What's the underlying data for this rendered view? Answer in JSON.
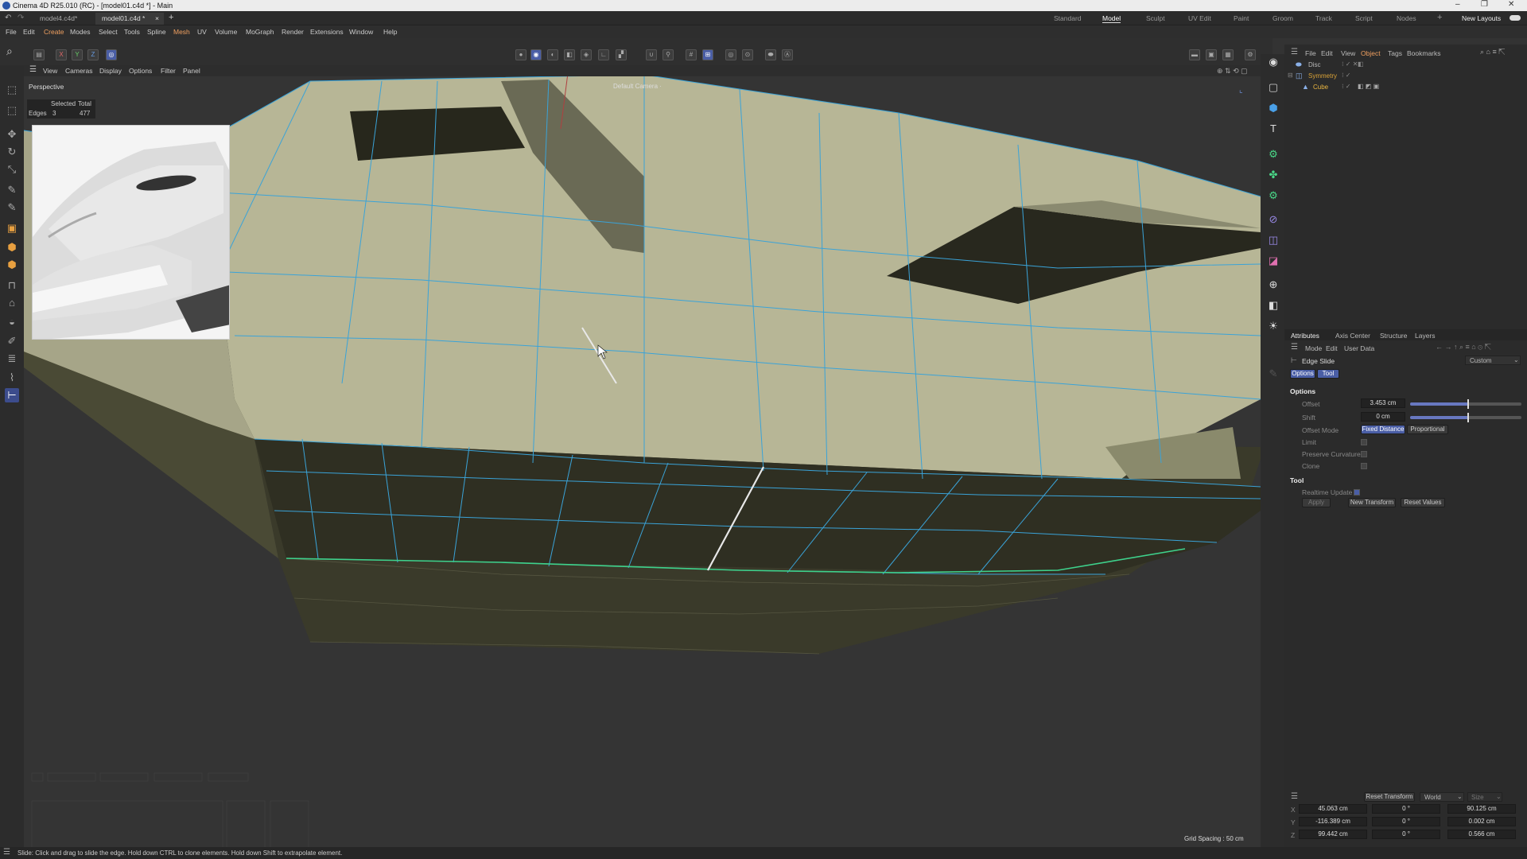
{
  "window": {
    "title": "Cinema 4D R25.010 (RC) - [model01.c4d *] - Main",
    "controls": [
      "–",
      "❐",
      "✕"
    ]
  },
  "tabs": {
    "docs": [
      "model4.c4d*",
      "model01.c4d *"
    ],
    "add": "+",
    "layouts": [
      "Standard",
      "Model",
      "Sculpt",
      "UV Edit",
      "Paint",
      "Groom",
      "Track",
      "Script",
      "Nodes"
    ],
    "active_layout": "Model",
    "new_layouts": "New Layouts"
  },
  "menu": [
    "File",
    "Edit",
    "Create",
    "Modes",
    "Select",
    "Tools",
    "Spline",
    "Mesh",
    "UV",
    "Volume",
    "MoGraph",
    "Render",
    "Extensions",
    "Window",
    "Help"
  ],
  "toolbar": {
    "axis_x": "X",
    "axis_y": "Y",
    "axis_z": "Z"
  },
  "viewport": {
    "menu": [
      "View",
      "Cameras",
      "Display",
      "Options",
      "Filter",
      "Panel"
    ],
    "name": "Perspective",
    "camera": "Default Camera",
    "camera_suffix": "·",
    "stats_header": [
      "Selected",
      "Total"
    ],
    "stats_row": {
      "label": "Edges",
      "selected": "3",
      "total": "477"
    },
    "grid_spacing": "Grid Spacing : 50 cm"
  },
  "objects": {
    "menu": [
      "File",
      "Edit",
      "View",
      "Object",
      "Tags",
      "Bookmarks"
    ],
    "items": [
      {
        "name": "Disc",
        "color": "#c8c8c8"
      },
      {
        "name": "Symmetry",
        "color": "#d9a237"
      },
      {
        "name": "Cube",
        "color": "#e8b540"
      }
    ]
  },
  "attributes": {
    "tabs": [
      "Attributes",
      "Axis Center",
      "Structure",
      "Layers"
    ],
    "menu": [
      "Mode",
      "Edit",
      "User Data"
    ],
    "tool_name": "Edge Slide",
    "preset": "Custom",
    "subtabs": [
      "Options",
      "Tool"
    ],
    "section_options": "Options",
    "offset_label": "Offset",
    "offset_value": "3.453 cm",
    "offset_fraction": 0.52,
    "shift_label": "Shift",
    "shift_value": "0 cm",
    "shift_fraction": 0.52,
    "offset_mode_label": "Offset Mode",
    "offset_mode_options": [
      "Fixed Distance",
      "Proportional"
    ],
    "limit_label": "Limit",
    "preserve_curvature_label": "Preserve Curvature",
    "clone_label": "Clone",
    "section_tool": "Tool",
    "realtime_label": "Realtime Update",
    "apply_label": "Apply",
    "new_transform_label": "New Transform",
    "reset_values_label": "Reset Values"
  },
  "coordinates": {
    "reset_transform": "Reset Transform",
    "space": "World",
    "size_label": "Size",
    "rows": [
      {
        "axis": "X",
        "pos": "45.063 cm",
        "rot": "0 °",
        "size": "90.125 cm"
      },
      {
        "axis": "Y",
        "pos": "-116.389 cm",
        "rot": "0 °",
        "size": "0.002 cm"
      },
      {
        "axis": "Z",
        "pos": "99.442 cm",
        "rot": "0 °",
        "size": "0.566 cm"
      }
    ]
  },
  "status": {
    "text": "Slide: Click and drag to slide the edge. Hold down CTRL to clone elements. Hold down Shift to extrapolate element."
  },
  "colors": {
    "accent": "#4a5ea6",
    "wire": "#3aa3d8",
    "selected_edge": "#e8e8e8",
    "loop_edge": "#3ed28c"
  }
}
